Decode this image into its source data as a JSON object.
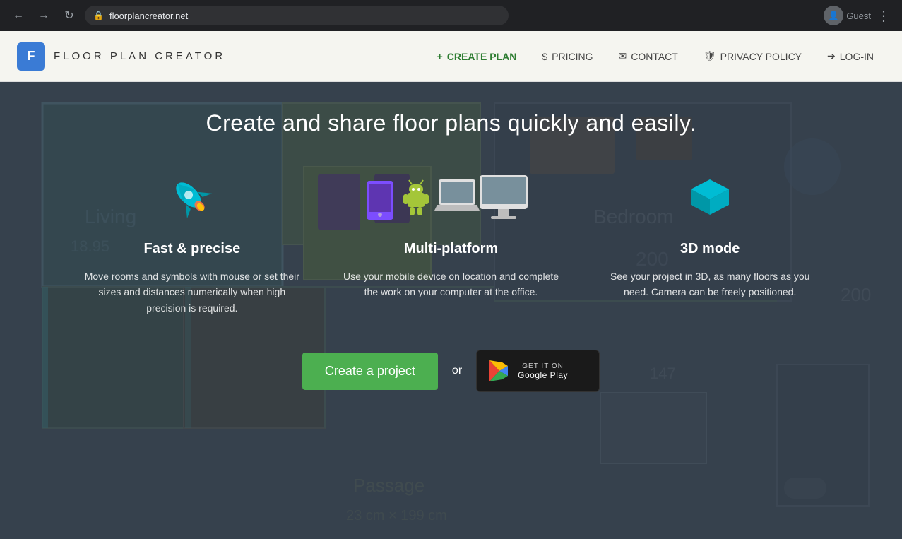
{
  "browser": {
    "url": "floorplancreator.net",
    "back_icon": "◀",
    "forward_icon": "▶",
    "refresh_icon": "↻",
    "guest_label": "Guest",
    "menu_icon": "⋮"
  },
  "navbar": {
    "logo_letter": "F",
    "logo_text": "FLOOR PLAN CREATOR",
    "nav_items": [
      {
        "id": "create-plan",
        "icon": "+",
        "label": "CREATE PLAN",
        "class": "create-plan"
      },
      {
        "id": "pricing",
        "icon": "$",
        "label": "PRICING"
      },
      {
        "id": "contact",
        "icon": "✉",
        "label": "CONTACT"
      },
      {
        "id": "privacy",
        "icon": "🛡",
        "label": "PRIVACY POLICY"
      },
      {
        "id": "login",
        "icon": "→",
        "label": "LOG-IN"
      }
    ]
  },
  "hero": {
    "headline": "Create and share floor plans quickly and easily.",
    "features": [
      {
        "id": "fast-precise",
        "title": "Fast & precise",
        "desc": "Move rooms and symbols with mouse or set their sizes and distances numerically when high precision is required."
      },
      {
        "id": "multi-platform",
        "title": "Multi-platform",
        "desc": "Use your mobile device on location and complete the work on your computer at the office."
      },
      {
        "id": "3d-mode",
        "title": "3D mode",
        "desc": "See your project in 3D, as many floors as you need. Camera can be freely positioned."
      }
    ],
    "cta": {
      "create_label": "Create a project",
      "or_label": "or",
      "play_get": "GET IT ON",
      "play_store": "Google Play"
    }
  }
}
